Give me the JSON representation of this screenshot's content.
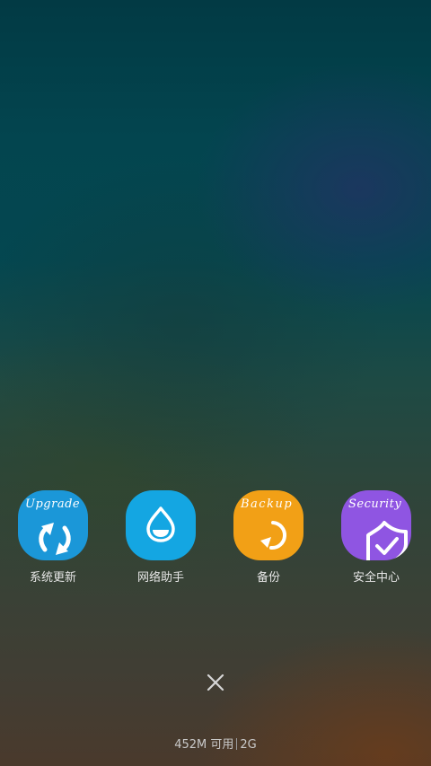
{
  "apps": [
    {
      "id": "upgrade",
      "label": "系统更新",
      "tile_text": "Upgrade",
      "color": "#1b97d8",
      "icon": "refresh-arrows-icon"
    },
    {
      "id": "network",
      "label": "网络助手",
      "tile_text": "",
      "color": "#14a6e2",
      "icon": "water-drop-icon"
    },
    {
      "id": "backup",
      "label": "备份",
      "tile_text": "Backup",
      "color": "#f2a016",
      "icon": "restore-arrow-icon"
    },
    {
      "id": "security",
      "label": "安全中心",
      "tile_text": "Security",
      "color": "#8f55e2",
      "icon": "shield-check-icon"
    }
  ],
  "close_icon": "close-icon",
  "memory": {
    "free": "452M",
    "free_label": "可用",
    "total": "2G"
  }
}
